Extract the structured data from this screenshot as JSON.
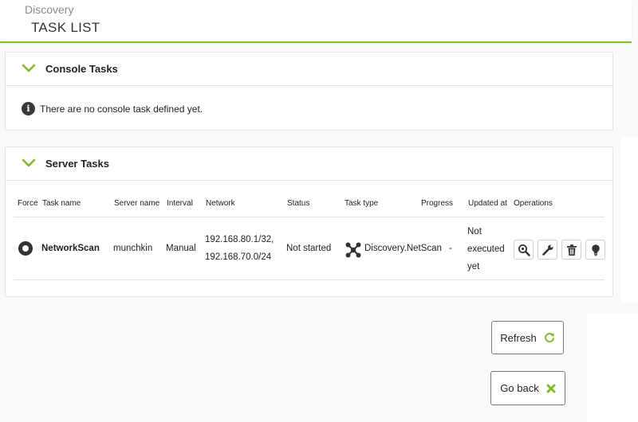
{
  "header": {
    "breadcrumb": "Discovery",
    "title": "TASK LIST"
  },
  "console_tasks": {
    "title": "Console Tasks",
    "message": "There are no console task defined yet."
  },
  "server_tasks": {
    "title": "Server Tasks",
    "columns": {
      "force": "Force",
      "task_name": "Task name",
      "server_name": "Server name",
      "interval": "Interval",
      "network": "Network",
      "status": "Status",
      "task_type": "Task type",
      "progress": "Progress",
      "updated_at": "Updated at",
      "operations": "Operations"
    },
    "rows": [
      {
        "task_name": "NetworkScan",
        "server_name": "munchkin",
        "interval": "Manual",
        "network_line1": "192.168.80.1/32,",
        "network_line2": "192.168.70.0/24",
        "status": "Not started",
        "task_type": "Discovery.NetScan",
        "progress": "-",
        "updated_line1": "Not",
        "updated_line2": "executed",
        "updated_line3": "yet",
        "operations": [
          "magnifier-icon",
          "wrench-icon",
          "trash-icon",
          "lightbulb-icon"
        ]
      }
    ]
  },
  "buttons": {
    "refresh": "Refresh",
    "go_back": "Go back"
  },
  "colors": {
    "accent": "#82b92e",
    "border": "#e2e2e2"
  }
}
